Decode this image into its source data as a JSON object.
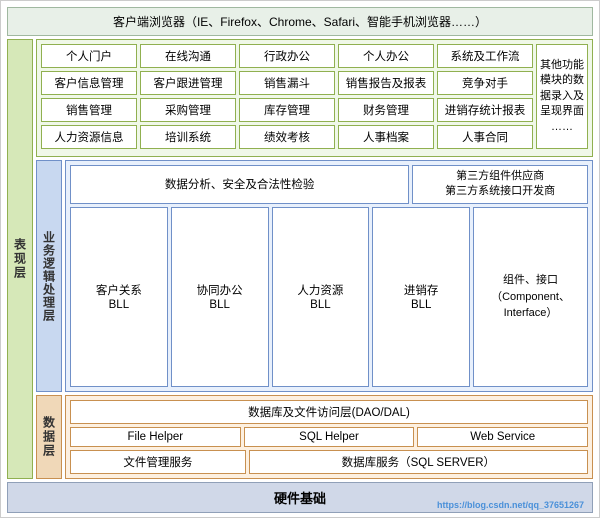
{
  "browser_bar": "客户端浏览器（IE、Firefox、Chrome、Safari、智能手机浏览器……）",
  "layers": {
    "biaoxian": {
      "label": "表现层",
      "rows": [
        [
          "个人门户",
          "在线沟通",
          "行政办公",
          "个人办公",
          "系统及工作流"
        ],
        [
          "客户信息管理",
          "客户跟进管理",
          "销售漏斗",
          "销售报告及报表",
          "竞争对手"
        ],
        [
          "销售管理",
          "采购管理",
          "库存管理",
          "财务管理",
          "进销存统计报表"
        ],
        [
          "人力资源信息",
          "培训系统",
          "绩效考核",
          "人事档案",
          "人事合同"
        ]
      ],
      "other_label": "其他功能模块的数据录入及呈现界面",
      "other_dots": "……"
    },
    "yewu": {
      "label": "业务逻辑处理层",
      "top_left": "数据分析、安全及合法性检验",
      "top_right": "第三方组件供应商\n第三方系统接口开发商",
      "bll_items": [
        {
          "top": "客户关系",
          "bottom": "BLL"
        },
        {
          "top": "协同办公",
          "bottom": "BLL"
        },
        {
          "top": "人力资源",
          "bottom": "BLL"
        },
        {
          "top": "进销存",
          "bottom": "BLL"
        }
      ],
      "component_label": "组件、接口\n（Component、Interface）"
    },
    "shuju": {
      "label": "数据层",
      "dao_label": "数据库及文件访问层(DAO/DAL)",
      "items": [
        "File Helper",
        "SQL Helper",
        "Web Service"
      ],
      "bottom_left": "文件管理服务",
      "bottom_right": "数据库服务（SQL SERVER）"
    }
  },
  "hardware": "硬件基础",
  "watermark": "https://blog.csdn.net/qq_37651267"
}
